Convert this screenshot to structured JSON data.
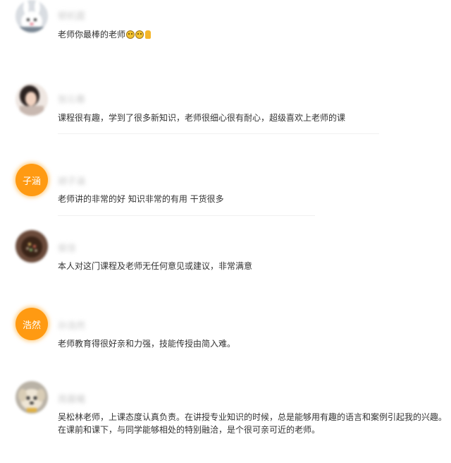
{
  "comments": [
    {
      "username": "顿机霆",
      "avatar": "cartoon-rabbit-avatar",
      "text": "老师你最棒的老师",
      "emojis": [
        "crying-face-emoji",
        "crying-face-emoji",
        "thumbs-up-emoji"
      ]
    },
    {
      "username": "张沁春",
      "avatar": "photo-avatar-girl",
      "text": "课程很有趣，学到了很多新知识，老师很细心很有耐心，超级喜欢上老师的课"
    },
    {
      "username": "胡子涵",
      "avatar_text": "子涵",
      "text": "老师讲的非常的好 知识非常的有用 干货很多"
    },
    {
      "username": "侯佳",
      "avatar": "photo-avatar-dessert",
      "text": "本人对这门课程及老师无任何意见或建议，非常满意"
    },
    {
      "username": "孙浩然",
      "avatar_text": "浩然",
      "text": "老师教育得很好亲和力强，技能传授由简入难。"
    },
    {
      "username": "周晨曦",
      "avatar": "photo-avatar-dog",
      "text_line1": "吴松林老师，上课态度认真负责。在讲授专业知识的时候，总是能够用有趣的语言和案例引起我的兴趣。",
      "text_line2": "在课前和课下，与同学能够相处的特别融洽，是个很可亲可近的老师。"
    }
  ],
  "colors": {
    "text_avatar_bg": "#ff9a12",
    "username": "#c9c9c9",
    "comment_text": "#333333"
  }
}
